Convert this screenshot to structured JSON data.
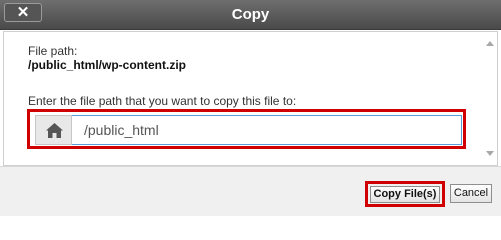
{
  "titlebar": {
    "close_glyph": "✕",
    "title": "Copy"
  },
  "form": {
    "file_path_label": "File path:",
    "file_path_value": "/public_html/wp-content.zip",
    "prompt_label": "Enter the file path that you want to copy this file to:",
    "destination_value": "/public_html"
  },
  "footer": {
    "copy_label": "Copy File(s)",
    "cancel_label": "Cancel"
  },
  "icons": {
    "home": "home-icon",
    "close": "close-icon"
  },
  "colors": {
    "title_bar": "#4a4a4a",
    "highlight": "#d00000",
    "input_border": "#5b9dd9"
  }
}
